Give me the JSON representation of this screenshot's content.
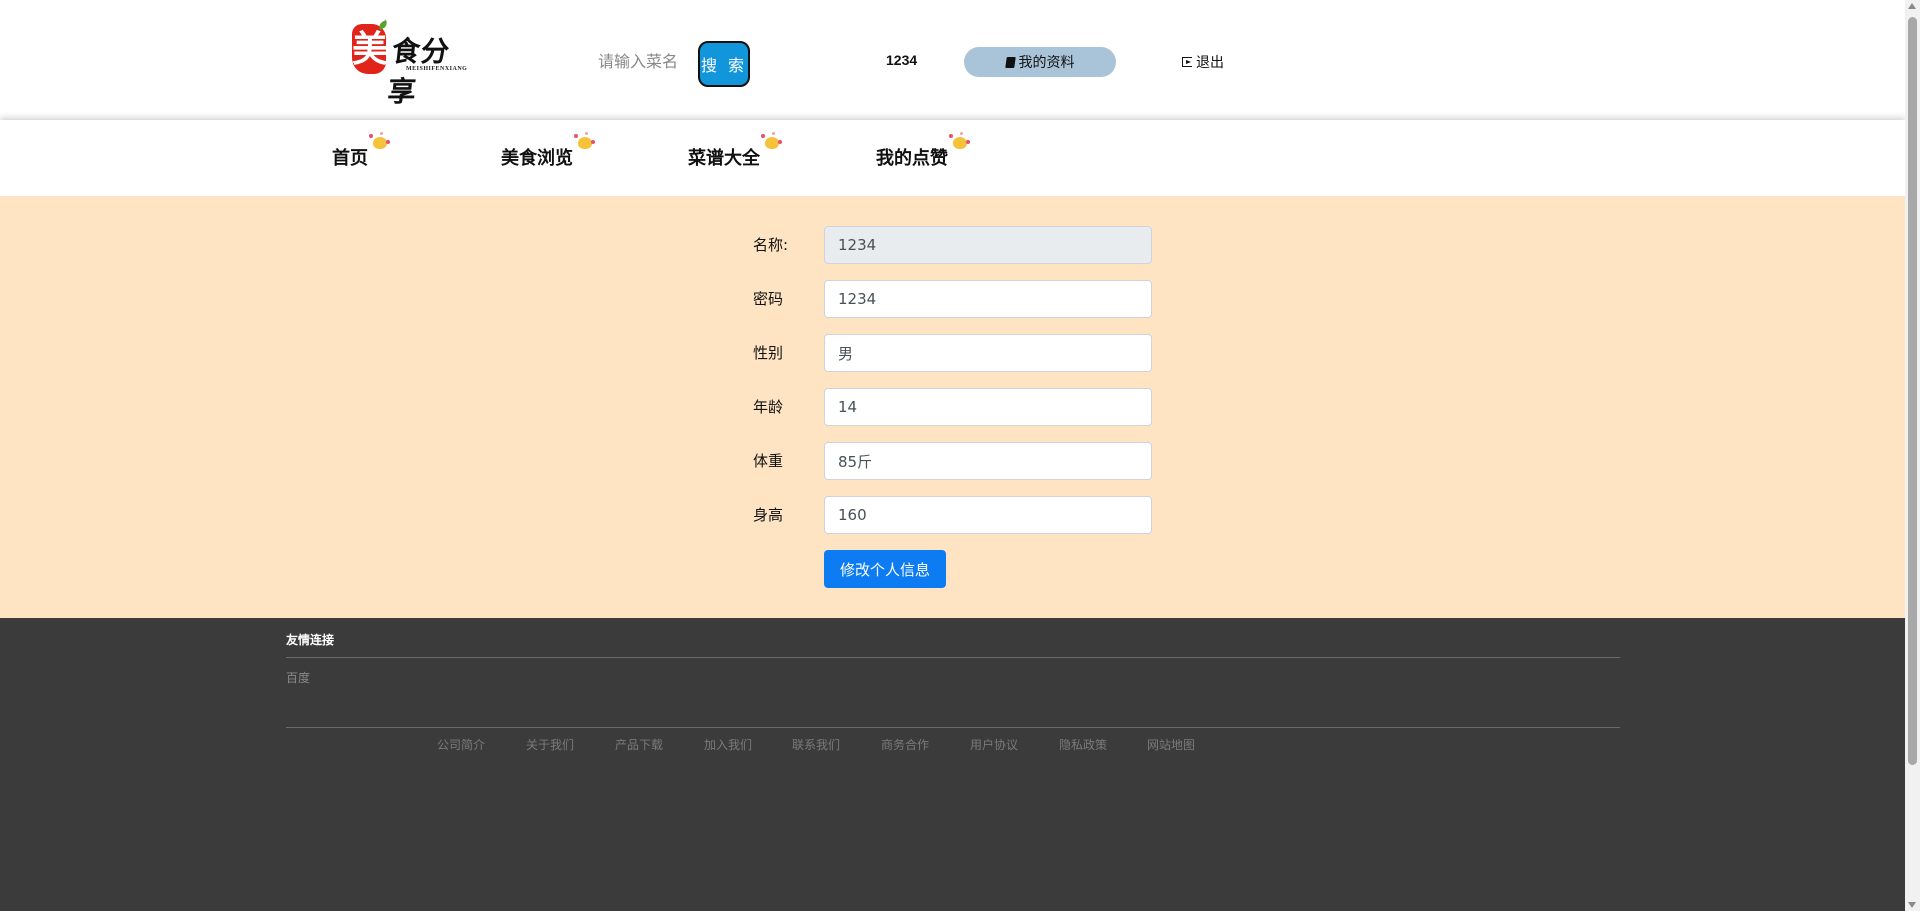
{
  "header": {
    "logo": {
      "brand_char": "美",
      "brand_rest": "食分享",
      "brand_sub": "MEISHIFENXIANG"
    },
    "search": {
      "placeholder": "请输入菜名",
      "button_label": "搜 索"
    },
    "username": "1234",
    "profile_label": "我的资料",
    "logout_label": "退出"
  },
  "nav": {
    "items": [
      {
        "label": "首页"
      },
      {
        "label": "美食浏览"
      },
      {
        "label": "菜谱大全"
      },
      {
        "label": "我的点赞"
      }
    ]
  },
  "form": {
    "fields": [
      {
        "label": "名称:",
        "value": "1234",
        "readonly": true
      },
      {
        "label": "密码",
        "value": "1234"
      },
      {
        "label": "性别",
        "value": "男"
      },
      {
        "label": "年龄",
        "value": "14"
      },
      {
        "label": "体重",
        "value": "85斤"
      },
      {
        "label": "身高",
        "value": "160"
      }
    ],
    "submit_label": "修改个人信息"
  },
  "footer": {
    "title": "友情连接",
    "links": [
      "百度"
    ],
    "nav": [
      "公司简介",
      "关于我们",
      "产品下载",
      "加入我们",
      "联系我们",
      "商务合作",
      "用户协议",
      "隐私政策",
      "网站地图"
    ]
  },
  "colors": {
    "content_bg": "#ffe4c4",
    "footer_bg": "#3b3b3b",
    "search_button": "#1296db",
    "profile_button": "#a9c4d9",
    "submit_button": "#0d7cf2"
  },
  "icons": {
    "profile": "book-icon",
    "logout": "sign-out-icon",
    "nav_decoration": "sparkle-icon"
  }
}
